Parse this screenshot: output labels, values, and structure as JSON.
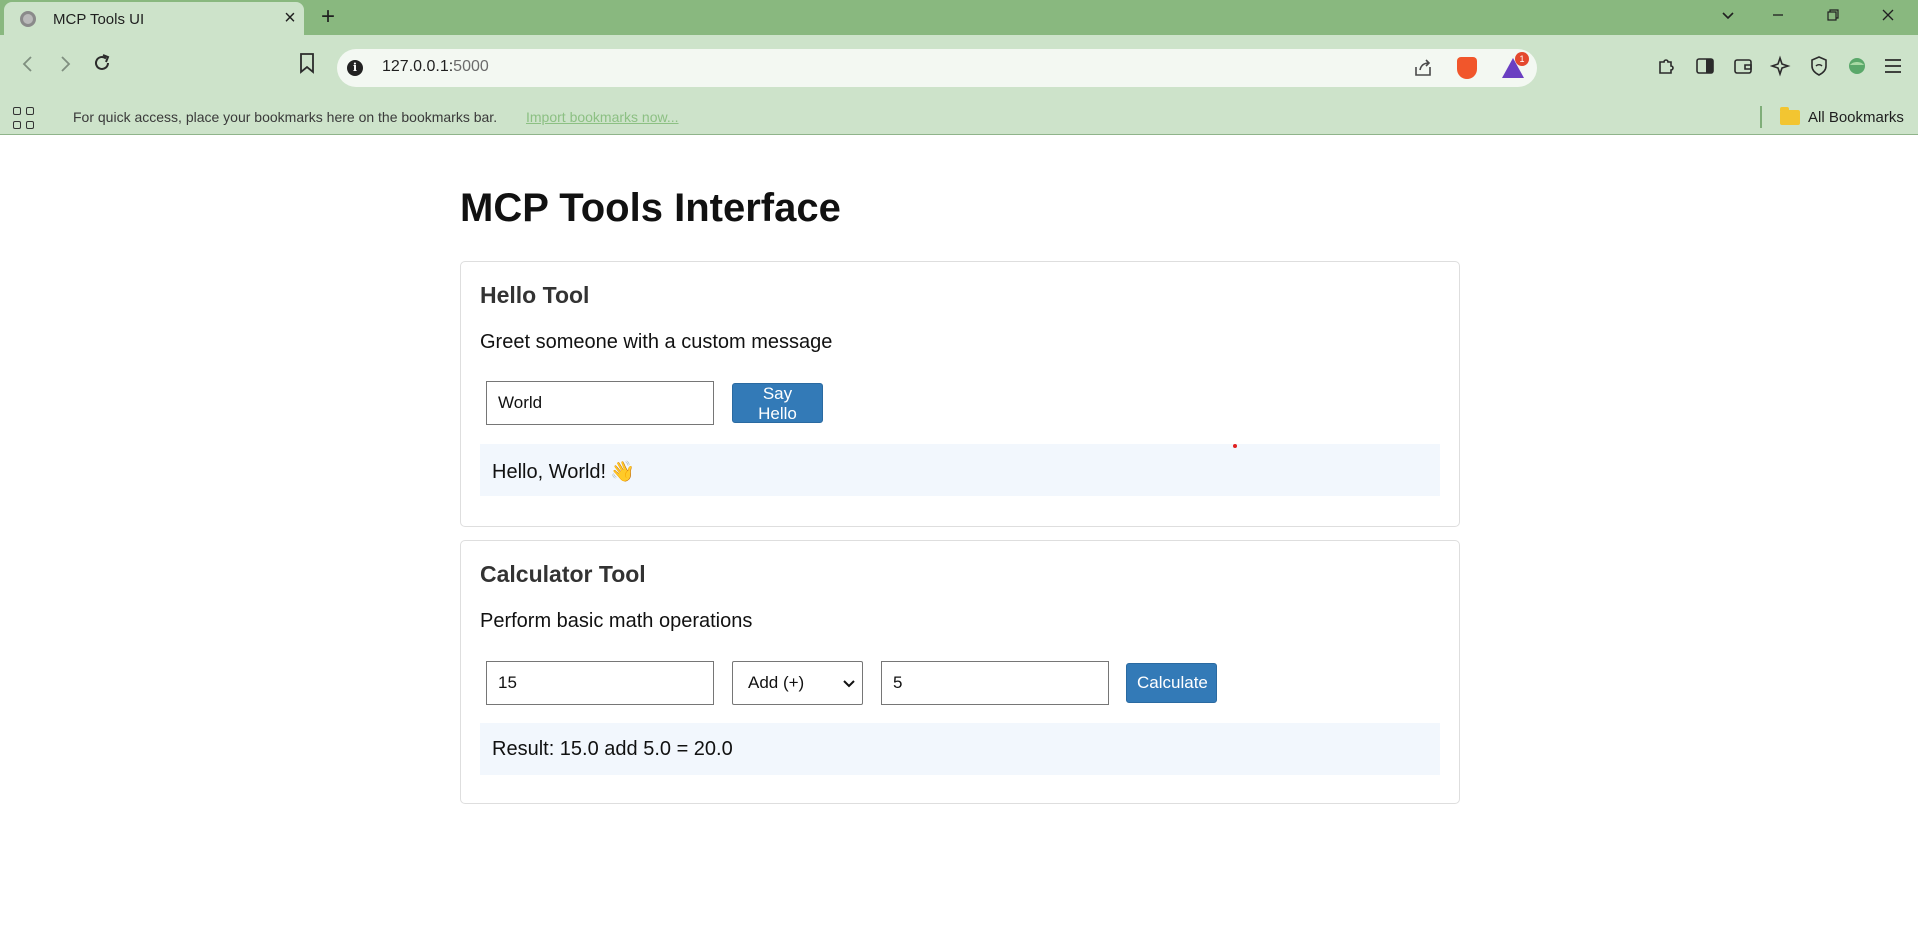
{
  "browser": {
    "tab_title": "MCP Tools UI",
    "tab_close": "×",
    "new_tab": "+",
    "url_host": "127.0.0.1:",
    "url_port": "5000",
    "rewards_badge": "1",
    "bookmarks_prompt": "For quick access, place your bookmarks here on the bookmarks bar.",
    "import_link": "Import bookmarks now...",
    "all_bookmarks": "All Bookmarks"
  },
  "page": {
    "title": "MCP Tools Interface"
  },
  "hello_tool": {
    "title": "Hello Tool",
    "description": "Greet someone with a custom message",
    "name_value": "World",
    "button_label": "Say Hello",
    "result": "Hello, World!",
    "result_emoji": "👋"
  },
  "calculator_tool": {
    "title": "Calculator Tool",
    "description": "Perform basic math operations",
    "operand_a": "15",
    "operation": "Add (+)",
    "operand_b": "5",
    "button_label": "Calculate",
    "result": "Result: 15.0 add 5.0 = 20.0"
  },
  "colors": {
    "chrome_top": "#89b87f",
    "chrome_toolbar": "#cde3ca",
    "button_blue": "#337ab7",
    "result_bg": "#f2f7fd"
  }
}
